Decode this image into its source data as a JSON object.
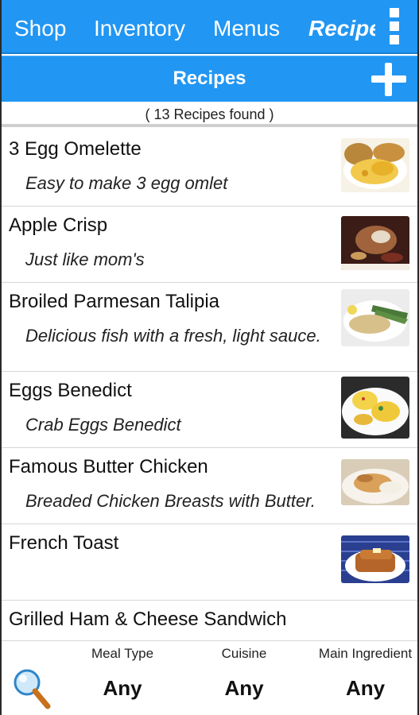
{
  "tabs": [
    {
      "label": "Shop"
    },
    {
      "label": "Inventory"
    },
    {
      "label": "Menus"
    },
    {
      "label": "Recipes"
    }
  ],
  "overflow_menu_icon": "kebab-vertical-icon",
  "header": {
    "title": "Recipes",
    "add_icon": "plus-icon"
  },
  "count_text": "( 13 Recipes found )",
  "recipes": [
    {
      "name": "3 Egg Omelette",
      "description": "Easy to make 3 egg omlet",
      "thumbnail": "omelette-photo"
    },
    {
      "name": "Apple Crisp",
      "description": "Just like mom's",
      "thumbnail": "apple-crisp-photo"
    },
    {
      "name": "Broiled Parmesan Talipia",
      "description": "Delicious fish with a fresh, light sauce.",
      "thumbnail": "fish-photo"
    },
    {
      "name": "Eggs Benedict",
      "description": "Crab Eggs Benedict",
      "thumbnail": "eggs-benedict-photo"
    },
    {
      "name": "Famous Butter Chicken",
      "description": "Breaded Chicken Breasts with Butter.",
      "thumbnail": "butter-chicken-photo"
    },
    {
      "name": "French Toast",
      "description": "",
      "thumbnail": "french-toast-photo"
    },
    {
      "name": "Grilled Ham & Cheese Sandwich",
      "description": "",
      "thumbnail": ""
    }
  ],
  "filters": {
    "search_icon": "magnifier-icon",
    "meal_type": {
      "label": "Meal Type",
      "value": "Any"
    },
    "cuisine": {
      "label": "Cuisine",
      "value": "Any"
    },
    "main_ingredient": {
      "label": "Main Ingredient",
      "value": "Any"
    }
  },
  "colors": {
    "accent": "#2196f3",
    "text": "#111111",
    "divider": "#d6d6d6"
  }
}
